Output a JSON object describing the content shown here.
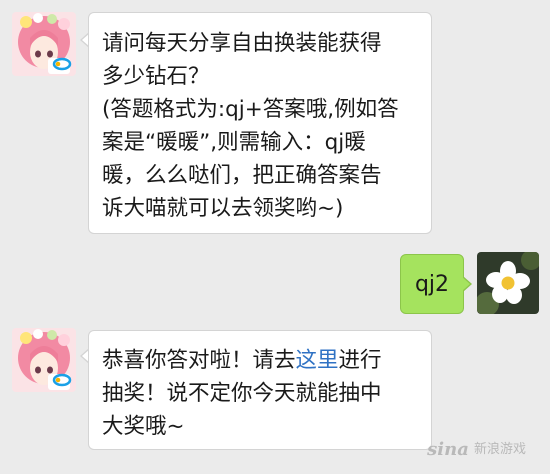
{
  "messages": [
    {
      "from": "bot",
      "text": "请问每天分享自由换装能获得\n多少钻石？\n(答题格式为:qj+答案哦,例如答\n案是“暖暖”,则需输入：qj暖\n暖，么么哒们，把正确答案告\n诉大喵就可以去领奖哟~)"
    },
    {
      "from": "user",
      "text": "qj2"
    },
    {
      "from": "bot",
      "text_before": "恭喜你答对啦！请去",
      "link_text": "这里",
      "text_after": "进行\n抽奖！说不定你今天就能抽中\n大奖哦~"
    }
  ],
  "watermark": {
    "brand": "sina",
    "text": "新浪游戏"
  },
  "colors": {
    "background": "#ebebeb",
    "incoming_bubble": "#ffffff",
    "outgoing_bubble": "#a5e35e",
    "link": "#2f72c4"
  },
  "icons": [
    "bot-avatar",
    "tencent-logo-icon",
    "user-avatar-flower"
  ]
}
